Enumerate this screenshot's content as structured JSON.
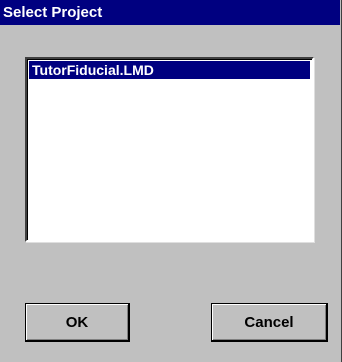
{
  "window": {
    "title": "Select Project"
  },
  "project_list": {
    "items": [
      {
        "label": "TutorFiducial.LMD",
        "selected": true
      }
    ]
  },
  "buttons": {
    "ok_label": "OK",
    "cancel_label": "Cancel"
  },
  "colors": {
    "title_bar": "#000080",
    "selection": "#000080",
    "face": "#c0c0c0"
  }
}
